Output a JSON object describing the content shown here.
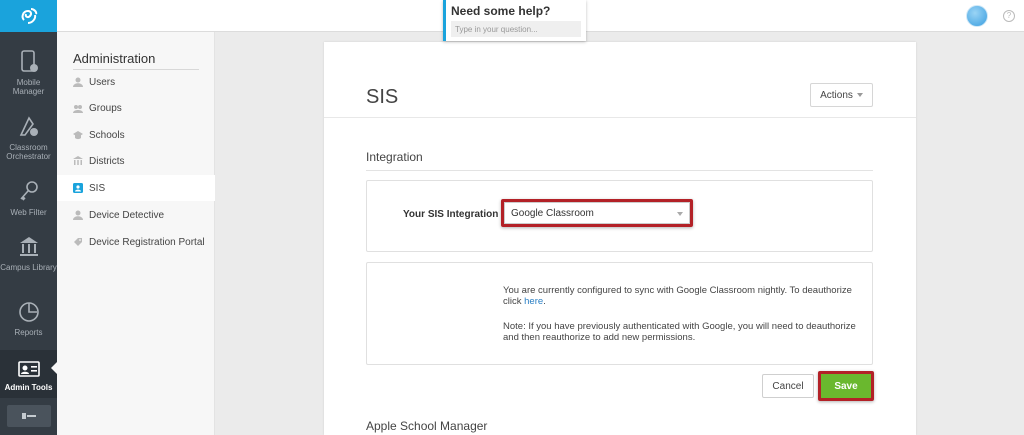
{
  "topbar": {
    "help_title": "Need some help?",
    "help_placeholder": "Type in your question..."
  },
  "leftnav": {
    "items": [
      {
        "label": "Mobile Manager",
        "icon": "mobile-device-icon"
      },
      {
        "label": "Classroom Orchestrator",
        "icon": "classroom-orchestrator-icon"
      },
      {
        "label": "Web Filter",
        "icon": "key-icon"
      },
      {
        "label": "Campus Library",
        "icon": "library-icon"
      },
      {
        "label": "Reports",
        "icon": "pie-chart-icon"
      },
      {
        "label": "Admin Tools",
        "icon": "admin-id-card-icon",
        "active": true
      }
    ]
  },
  "admin": {
    "title": "Administration",
    "items": [
      {
        "label": "Users",
        "icon": "user-icon"
      },
      {
        "label": "Groups",
        "icon": "group-icon"
      },
      {
        "label": "Schools",
        "icon": "graduation-cap-icon"
      },
      {
        "label": "Districts",
        "icon": "building-icon"
      },
      {
        "label": "SIS",
        "icon": "sis-icon",
        "active": true
      },
      {
        "label": "Device Detective",
        "icon": "detective-icon"
      },
      {
        "label": "Device Registration Portal",
        "icon": "tag-icon"
      }
    ]
  },
  "main": {
    "title": "SIS",
    "actions_label": "Actions",
    "integration": {
      "title": "Integration",
      "sis_label": "Your SIS Integration",
      "sis_value": "Google Classroom",
      "info_line1": "You are currently configured to sync with Google Classroom nightly. To deauthorize",
      "info_line2_prefix": "click ",
      "info_link": "here",
      "info_line2_suffix": ".",
      "note": "Note: If you have previously authenticated with Google, you will need to deauthorize and then reauthorize to add new permissions.",
      "cancel_label": "Cancel",
      "save_label": "Save"
    },
    "apple_title": "Apple School Manager"
  },
  "colors": {
    "brand_blue": "#1aa3dc",
    "nav_dark": "#343c44",
    "save_green": "#6ab82e",
    "highlight_red": "#b32127",
    "link_blue": "#2a7fc4"
  }
}
